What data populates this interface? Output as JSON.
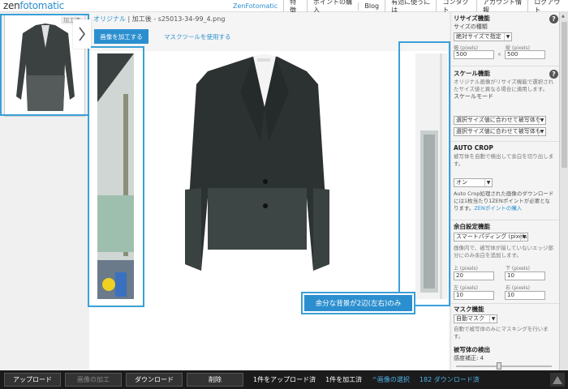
{
  "topbar": {
    "logo_prefix": "zen",
    "logo_suffix": "fotomatic",
    "nav": [
      "ZenFotomatic",
      "特徴",
      "ポイントの購入",
      "Blog",
      "有効に使うには",
      "コンタクト",
      "アカウント情報",
      "ログアウト"
    ]
  },
  "thumbnail": {
    "badge": "加工済"
  },
  "breadcrumb": {
    "original": "オリジナル",
    "separator": "|",
    "processed": "加工後",
    "dash": "-",
    "filename": "s25013-34-99_4.png"
  },
  "actions": {
    "process_button": "画像を加工する",
    "mask_tool_link": "マスクツールを使用する"
  },
  "callout": {
    "text": "余分な背景が2辺(左右)のみ"
  },
  "panel": {
    "resize": {
      "title": "リサイズ機能",
      "size_type_label": "サイズの種類",
      "size_type_value": "絶対サイズで指定",
      "width_label": "幅",
      "height_label": "縦",
      "unit": "(pixels)",
      "width_value": "500",
      "times": "×",
      "height_value": "500"
    },
    "scale": {
      "title": "スケール機能",
      "description": "オリジナル画像がリサイズ機能で選択されたサイズ値と異なる場合に適用します。",
      "mode_label": "スケールモード",
      "mode_value_1": "選択サイズ値に合わせて被写体を",
      "mode_value_2": "選択サイズ値に合わせて被写体も"
    },
    "autocrop": {
      "title": "AUTO CROP",
      "description": "被写体を自動で検出して余白を切り出します。",
      "value": "オン",
      "note": "Auto Crop処理された画像のダウンロードには1枚当たり1ZENポイントが必要となります。",
      "note_link": "ZENポイントの購入"
    },
    "margin": {
      "title": "余白設定機能",
      "value": "スマートパディング (pixels)",
      "description": "画像内で、被写体が接していないエッジ部分にのみ余白を追加します。",
      "top_label": "上 (pixels)",
      "bottom_label": "下 (pixels)",
      "left_label": "左 (pixels)",
      "right_label": "右 (pixels)",
      "top_value": "20",
      "bottom_value": "10",
      "left_value": "10",
      "right_value": "10"
    },
    "mask": {
      "title": "マスク機能",
      "value": "自動マスク",
      "description": "自動で被写体のみにマスキングを行います。"
    },
    "detect": {
      "title": "被写体の検出",
      "sensitivity": "感度補正: 4"
    }
  },
  "bottombar": {
    "upload": "アップロード",
    "process": "画像の加工",
    "download": "ダウンロード",
    "delete": "削除",
    "uploaded_status": "1件をアップロード済",
    "processed_status": "1件を加工済",
    "select_images": "^画像の選択",
    "downloaded": "182 ダウンロード済"
  },
  "colors": {
    "accent": "#2b8fcf",
    "highlight": "#3aa0d8",
    "bottom_bg": "#1b1b1b"
  }
}
